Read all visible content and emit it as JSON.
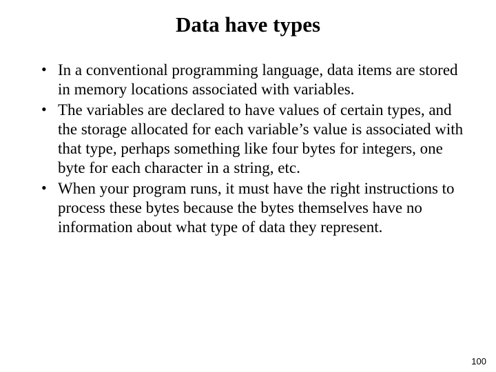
{
  "title": "Data have types",
  "bullets": [
    "In a conventional programming language, data items are stored in memory locations associated with variables.",
    "The variables are declared to have values of certain types, and the storage allocated for each variable’s value is associated with that type, perhaps something like four bytes for integers, one byte for each character in a string, etc.",
    "When your program runs, it must have the right instructions to process these bytes because the bytes themselves have no information about what type of data they represent."
  ],
  "page_number": "100"
}
